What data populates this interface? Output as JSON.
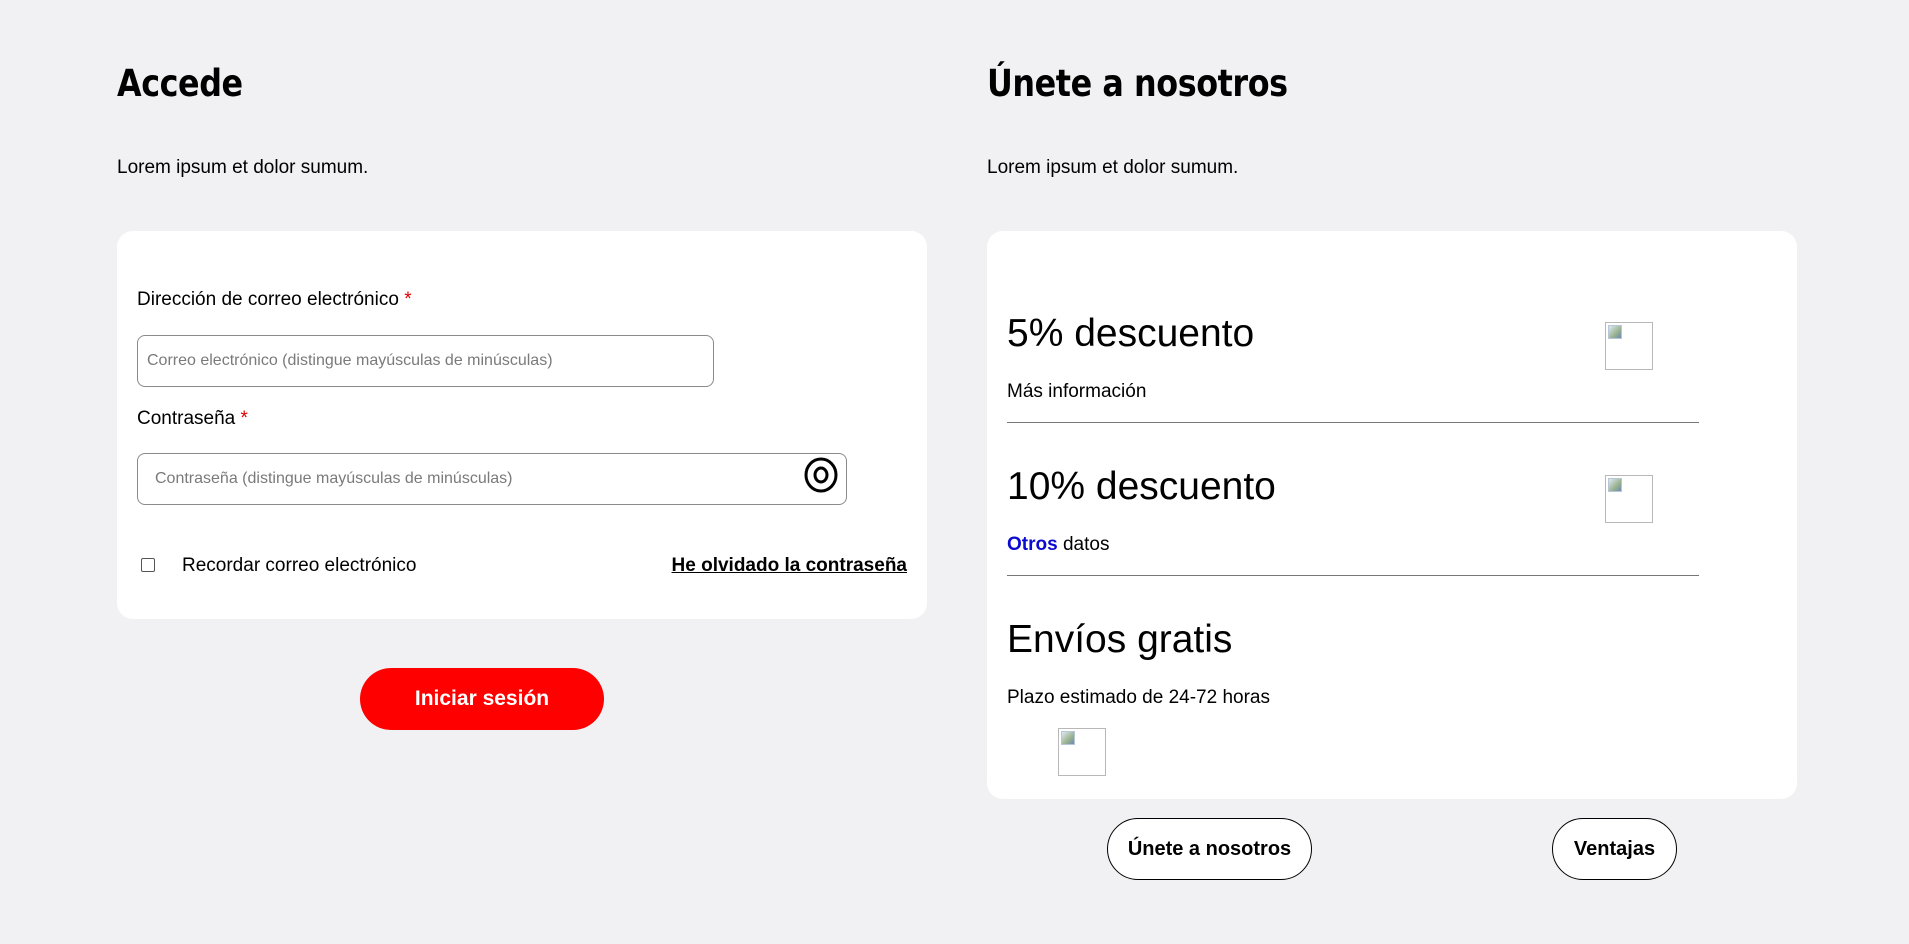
{
  "login": {
    "title": "Accede",
    "intro": "Lorem ipsum et dolor sumum.",
    "email_label": "Dirección de correo electrónico",
    "email_placeholder": "Correo electrónico (distingue mayúsculas de minúsculas)",
    "password_label": "Contraseña",
    "password_placeholder": "Contraseña (distingue mayúsculas de minúsculas)",
    "required_mark": "*",
    "remember_label": "Recordar correo electrónico",
    "remember_checked": false,
    "forgot_link": "He olvidado la contraseña",
    "submit_label": "Iniciar sesión"
  },
  "join": {
    "title": "Únete a nosotros",
    "intro": "Lorem ipsum et dolor sumum.",
    "benefits": [
      {
        "title": "5% descuento",
        "subtitle": "Más información",
        "icon": "broken-image-icon"
      },
      {
        "title": "10% descuento",
        "subtitle_accent": "Otros",
        "subtitle_rest": " datos",
        "icon": "broken-image-icon"
      },
      {
        "title": "Envíos gratis",
        "subtitle": "Plazo estimado de 24-72 horas",
        "icon": "broken-image-icon"
      }
    ],
    "join_button": "Únete a nosotros",
    "benefits_button": "Ventajas"
  },
  "colors": {
    "background": "#f1f1f3",
    "primary_button": "#ff0000",
    "required": "#e00000",
    "link_accent": "#0a0ad1"
  }
}
